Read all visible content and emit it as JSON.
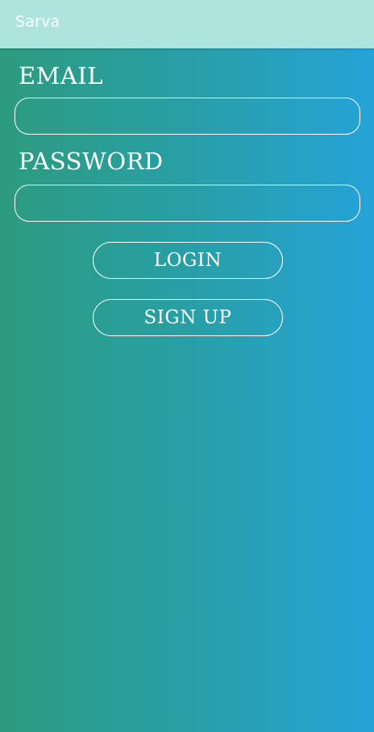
{
  "app_bar": {
    "title": "Sarva",
    "background": "#ade4de"
  },
  "form": {
    "email_label": "EMAIL",
    "email_value": "",
    "password_label": "PASSWORD",
    "password_value": "",
    "login_label": "LOGIN",
    "signup_label": "SIGN UP"
  },
  "colors": {
    "gradient_left": "#2d9b7f",
    "gradient_right": "#26a3d8",
    "text": "#ffffff"
  }
}
